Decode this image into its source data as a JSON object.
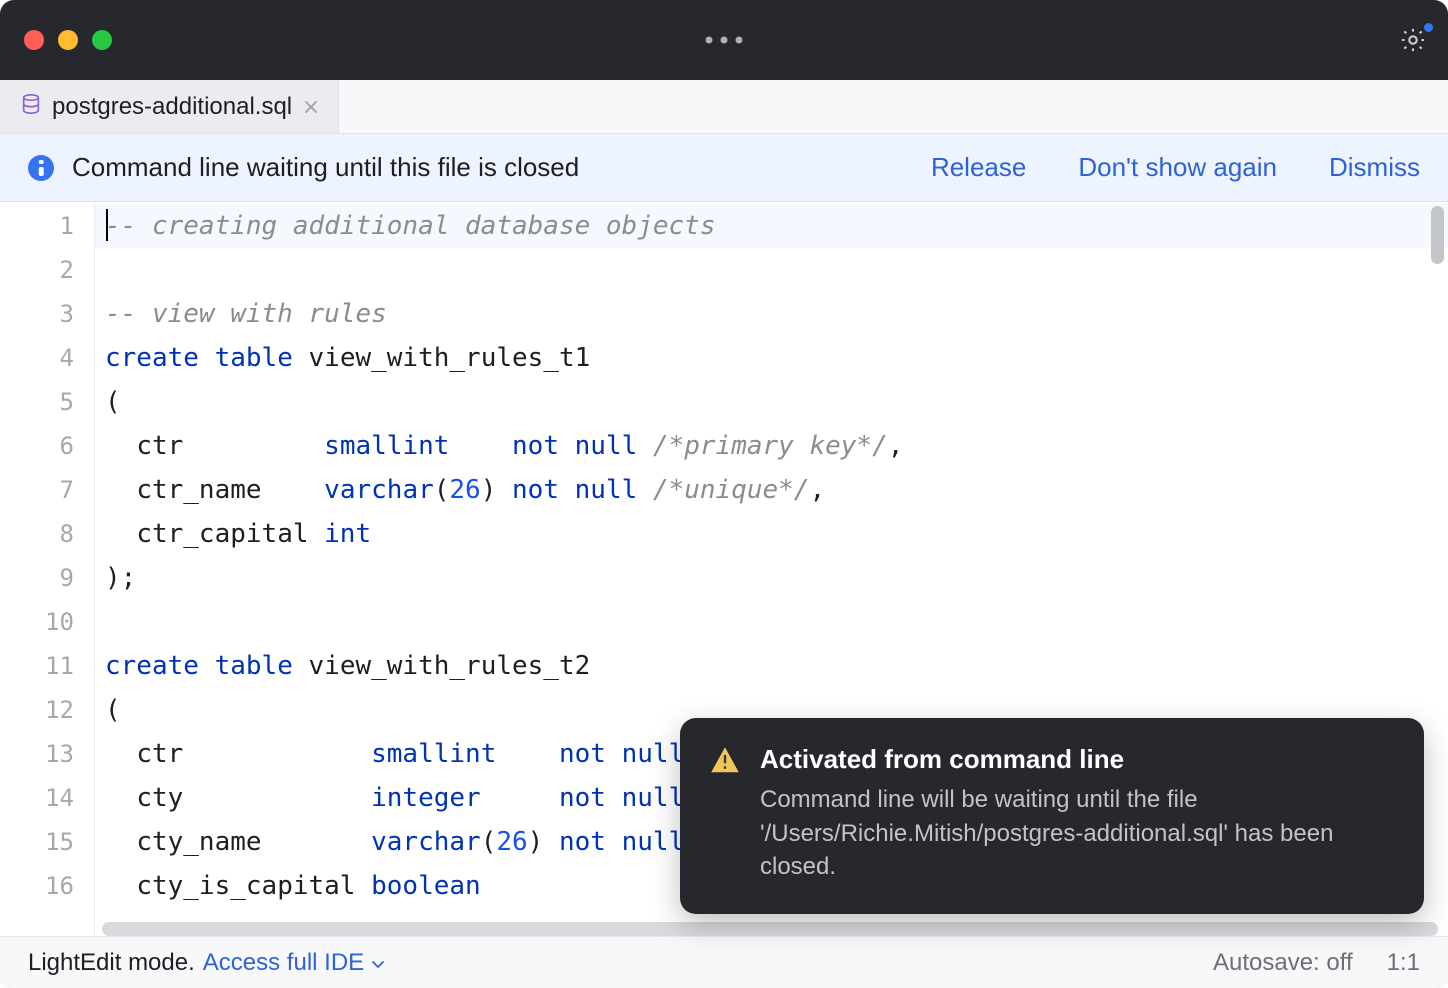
{
  "tab": {
    "filename": "postgres-additional.sql"
  },
  "banner": {
    "message": "Command line waiting until this file is closed",
    "release": "Release",
    "dont_show": "Don't show again",
    "dismiss": "Dismiss"
  },
  "editor": {
    "line_numbers": [
      "1",
      "2",
      "3",
      "4",
      "5",
      "6",
      "7",
      "8",
      "9",
      "10",
      "11",
      "12",
      "13",
      "14",
      "15",
      "16"
    ],
    "lines": [
      [
        {
          "c": "t-comment",
          "t": "-- creating additional database objects"
        }
      ],
      [],
      [
        {
          "c": "t-comment",
          "t": "-- view with rules"
        }
      ],
      [
        {
          "c": "t-kw",
          "t": "create"
        },
        {
          "t": " "
        },
        {
          "c": "t-kw",
          "t": "table"
        },
        {
          "t": " "
        },
        {
          "c": "t-id",
          "t": "view_with_rules_t1"
        }
      ],
      [
        {
          "c": "t-id",
          "t": "("
        }
      ],
      [
        {
          "t": "  "
        },
        {
          "c": "t-id",
          "t": "ctr"
        },
        {
          "t": "         "
        },
        {
          "c": "t-type",
          "t": "smallint"
        },
        {
          "t": "    "
        },
        {
          "c": "t-kw",
          "t": "not"
        },
        {
          "t": " "
        },
        {
          "c": "t-kw",
          "t": "null"
        },
        {
          "t": " "
        },
        {
          "c": "t-blockcomment",
          "t": "/*primary key*/"
        },
        {
          "c": "t-id",
          "t": ","
        }
      ],
      [
        {
          "t": "  "
        },
        {
          "c": "t-id",
          "t": "ctr_name"
        },
        {
          "t": "    "
        },
        {
          "c": "t-type",
          "t": "varchar"
        },
        {
          "c": "t-id",
          "t": "("
        },
        {
          "c": "t-num",
          "t": "26"
        },
        {
          "c": "t-id",
          "t": ")"
        },
        {
          "t": " "
        },
        {
          "c": "t-kw",
          "t": "not"
        },
        {
          "t": " "
        },
        {
          "c": "t-kw",
          "t": "null"
        },
        {
          "t": " "
        },
        {
          "c": "t-blockcomment",
          "t": "/*unique*/"
        },
        {
          "c": "t-id",
          "t": ","
        }
      ],
      [
        {
          "t": "  "
        },
        {
          "c": "t-id",
          "t": "ctr_capital"
        },
        {
          "t": " "
        },
        {
          "c": "t-type",
          "t": "int"
        }
      ],
      [
        {
          "c": "t-id",
          "t": ");"
        }
      ],
      [],
      [
        {
          "c": "t-kw",
          "t": "create"
        },
        {
          "t": " "
        },
        {
          "c": "t-kw",
          "t": "table"
        },
        {
          "t": " "
        },
        {
          "c": "t-id",
          "t": "view_with_rules_t2"
        }
      ],
      [
        {
          "c": "t-id",
          "t": "("
        }
      ],
      [
        {
          "t": "  "
        },
        {
          "c": "t-id",
          "t": "ctr"
        },
        {
          "t": "            "
        },
        {
          "c": "t-type",
          "t": "smallint"
        },
        {
          "t": "    "
        },
        {
          "c": "t-kw",
          "t": "not"
        },
        {
          "t": " "
        },
        {
          "c": "t-kw",
          "t": "null"
        }
      ],
      [
        {
          "t": "  "
        },
        {
          "c": "t-id",
          "t": "cty"
        },
        {
          "t": "            "
        },
        {
          "c": "t-type",
          "t": "integer"
        },
        {
          "t": "     "
        },
        {
          "c": "t-kw",
          "t": "not"
        },
        {
          "t": " "
        },
        {
          "c": "t-kw",
          "t": "null"
        }
      ],
      [
        {
          "t": "  "
        },
        {
          "c": "t-id",
          "t": "cty_name"
        },
        {
          "t": "       "
        },
        {
          "c": "t-type",
          "t": "varchar"
        },
        {
          "c": "t-id",
          "t": "("
        },
        {
          "c": "t-num",
          "t": "26"
        },
        {
          "c": "t-id",
          "t": ")"
        },
        {
          "t": " "
        },
        {
          "c": "t-kw",
          "t": "not"
        },
        {
          "t": " "
        },
        {
          "c": "t-kw",
          "t": "null"
        }
      ],
      [
        {
          "t": "  "
        },
        {
          "c": "t-id",
          "t": "cty_is_capital"
        },
        {
          "t": " "
        },
        {
          "c": "t-type",
          "t": "boolean"
        }
      ]
    ]
  },
  "statusbar": {
    "mode": "LightEdit mode.",
    "access_full_ide": "Access full IDE",
    "autosave": "Autosave: off",
    "position": "1:1"
  },
  "toast": {
    "title": "Activated from command line",
    "body": "Command line will be waiting until the file '/Users/Richie.Mitish/postgres-additional.sql' has been closed."
  }
}
